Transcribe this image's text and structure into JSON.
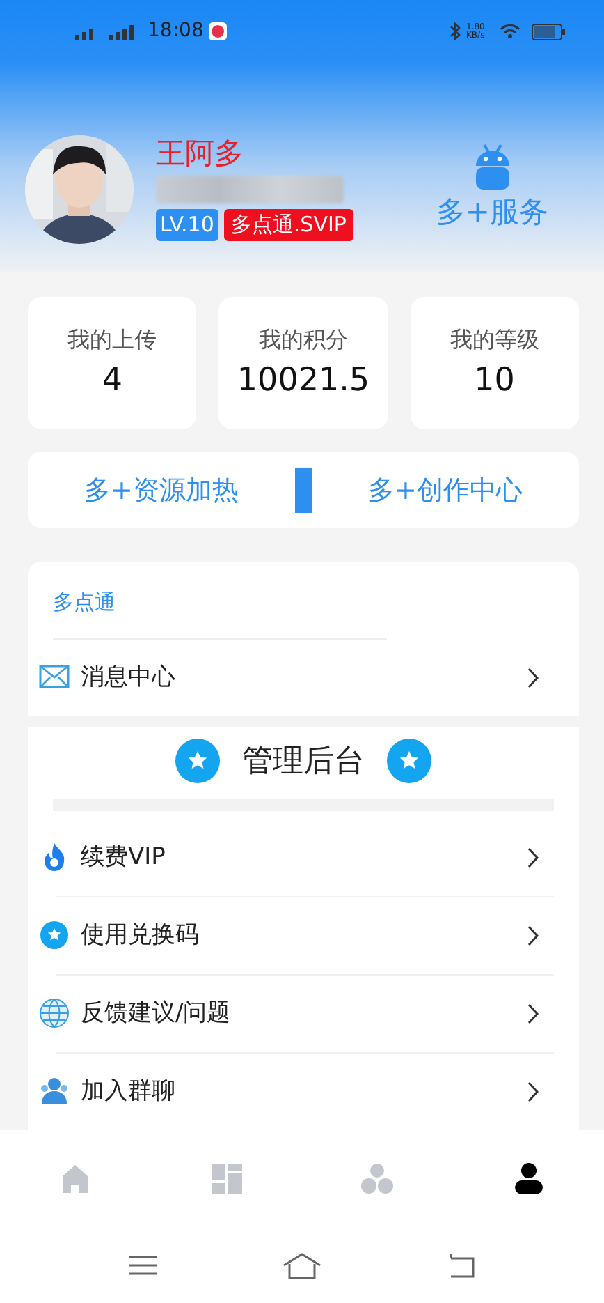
{
  "status_bar": {
    "time": "18:08",
    "network_speed": "1.80 KB/s"
  },
  "profile": {
    "name": "王阿多",
    "level_badge": "LV.10",
    "vip_badge": "多点通.SVIP"
  },
  "service_link": {
    "label": "多+服务"
  },
  "stats": [
    {
      "label": "我的上传",
      "value": "4"
    },
    {
      "label": "我的积分",
      "value": "10021.5"
    },
    {
      "label": "我的等级",
      "value": "10"
    }
  ],
  "actions": [
    {
      "label": "多+资源加热"
    },
    {
      "label": "多+创作中心"
    }
  ],
  "section": {
    "title": "多点通",
    "items": [
      {
        "kind": "mail",
        "label": "消息中心"
      }
    ]
  },
  "admin": {
    "title": "管理后台",
    "items": [
      {
        "kind": "flame",
        "label": "续费VIP"
      },
      {
        "kind": "star",
        "label": "使用兑换码"
      },
      {
        "kind": "globe",
        "label": "反馈建议/问题"
      },
      {
        "kind": "people",
        "label": "加入群聊"
      }
    ]
  },
  "tab_bar": [
    {
      "kind": "home",
      "selected": false
    },
    {
      "kind": "dashboard",
      "selected": false
    },
    {
      "kind": "circles",
      "selected": false
    },
    {
      "kind": "person",
      "selected": true
    }
  ]
}
